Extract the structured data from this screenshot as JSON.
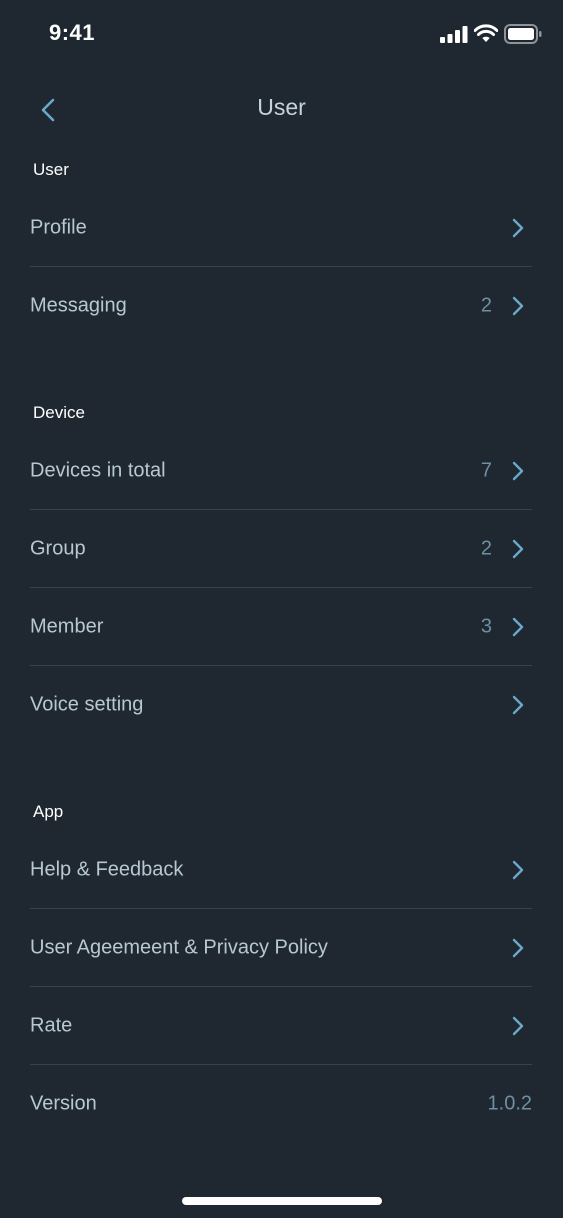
{
  "status_bar": {
    "time": "9:41",
    "icons": [
      "signal-icon",
      "wifi-icon",
      "battery-icon"
    ]
  },
  "nav": {
    "title": "User",
    "back_icon": "chevron-left-icon"
  },
  "sections": {
    "user": {
      "header": "User",
      "items": [
        {
          "label": "Profile",
          "value": ""
        },
        {
          "label": "Messaging",
          "value": "2"
        }
      ]
    },
    "device": {
      "header": "Device",
      "items": [
        {
          "label": "Devices in total",
          "value": "7"
        },
        {
          "label": "Group",
          "value": "2"
        },
        {
          "label": "Member",
          "value": "3"
        },
        {
          "label": "Voice setting",
          "value": ""
        }
      ]
    },
    "app": {
      "header": "App",
      "items": [
        {
          "label": "Help & Feedback",
          "value": ""
        },
        {
          "label": "User Ageemeent & Privacy Policy",
          "value": ""
        },
        {
          "label": "Rate",
          "value": ""
        },
        {
          "label": "Version",
          "value": "1.0.2"
        }
      ]
    }
  },
  "colors": {
    "background": "#1f2830",
    "label": "#b7c8d2",
    "value": "#6f8fa2",
    "accent_chevron": "#6aa8cc",
    "separator": "#37424b"
  }
}
